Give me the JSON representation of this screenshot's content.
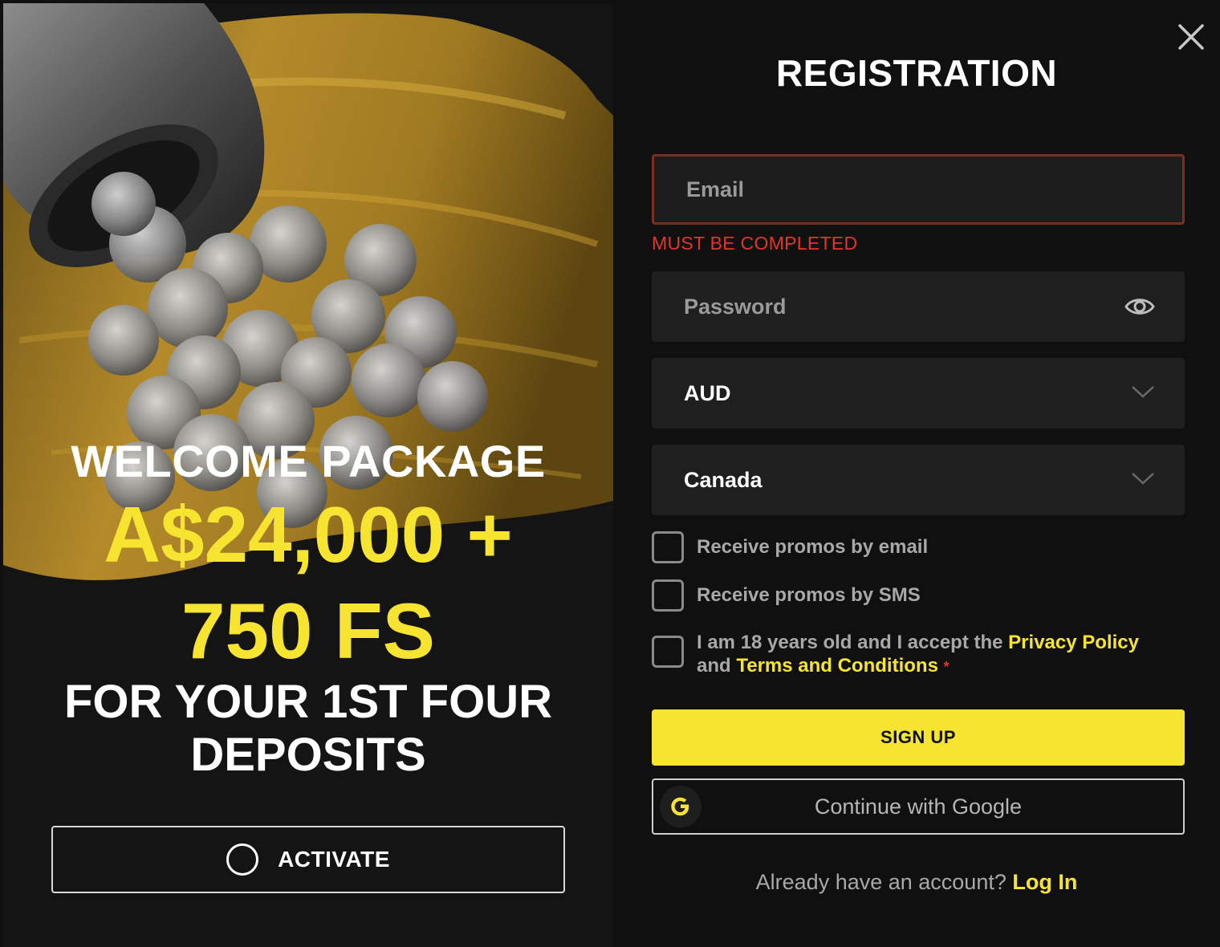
{
  "promo": {
    "headline": "WELCOME PACKAGE",
    "amount_line1": "A$24,000 +",
    "amount_line2": "750 FS",
    "subline1": "FOR YOUR 1ST FOUR",
    "subline2": "DEPOSITS",
    "activate_label": "ACTIVATE"
  },
  "form": {
    "title": "REGISTRATION",
    "email_placeholder": "Email",
    "email_value": "",
    "email_error": "MUST BE COMPLETED",
    "password_placeholder": "Password",
    "password_value": "",
    "currency_value": "AUD",
    "country_value": "Canada",
    "checkbox_email_label": "Receive promos by email",
    "checkbox_sms_label": "Receive promos by SMS",
    "terms_prefix": "I am 18 years old and I accept the ",
    "terms_privacy": "Privacy Policy",
    "terms_and": " and ",
    "terms_conditions": "Terms and Conditions",
    "terms_required_mark": "*",
    "signup_label": "SIGN UP",
    "google_label": "Continue with Google",
    "google_badge": "G",
    "login_prompt": "Already have an account? ",
    "login_link": "Log In"
  },
  "icons": {
    "close": "close-icon",
    "eye": "eye-icon",
    "chevron": "chevron-down-icon",
    "google": "google-icon",
    "activate": "circle-icon"
  },
  "colors": {
    "accent_yellow": "#f7e431",
    "error_red": "#e0372a",
    "background": "#101010",
    "field_bg": "#1f1f1f"
  },
  "checkbox_states": {
    "promos_email": false,
    "promos_sms": false,
    "age_terms": false
  }
}
